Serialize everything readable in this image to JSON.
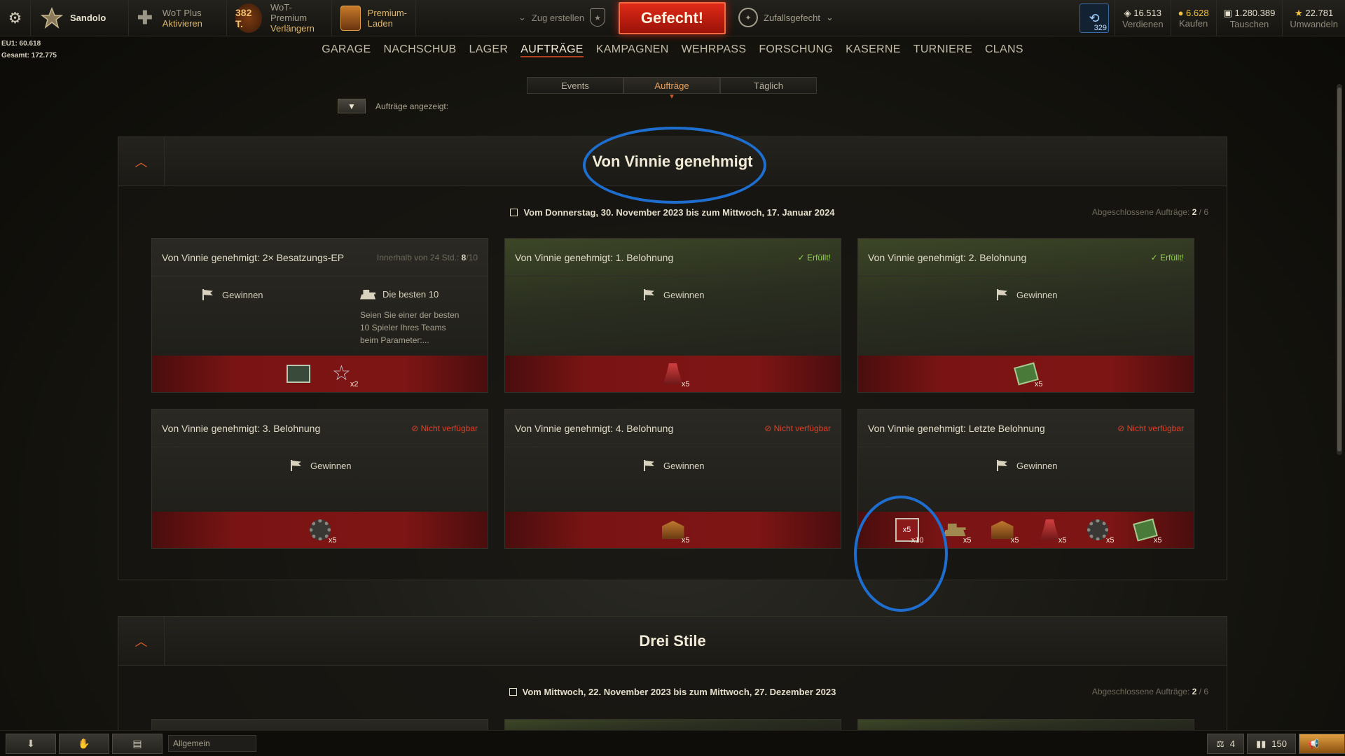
{
  "topbar": {
    "player_name": "Sandolo",
    "wot_plus_l1": "WoT Plus",
    "wot_plus_l2": "Aktivieren",
    "premium_days": "382 T.",
    "premium_l1": "WoT-Premium",
    "premium_l2": "Verlängern",
    "shop_l1": "Premium-",
    "shop_l2": "Laden",
    "platoon": "Zug erstellen",
    "battle_button": "Gefecht!",
    "battle_mode": "Zufallsgefecht",
    "bonds_count": "329",
    "currencies": [
      {
        "value": "16.513",
        "label": "Verdienen",
        "icon": "credits-icon"
      },
      {
        "value": "6.628",
        "label": "Kaufen",
        "icon": "gold-icon"
      },
      {
        "value": "1.280.389",
        "label": "Tauschen",
        "icon": "free-xp-icon"
      },
      {
        "value": "22.781",
        "label": "Umwandeln",
        "icon": "star-xp-icon"
      }
    ]
  },
  "stats": {
    "eu": "EU1: 60.618",
    "total": "Gesamt: 172.775"
  },
  "nav": [
    "GARAGE",
    "NACHSCHUB",
    "LAGER",
    "AUFTRÄGE",
    "KAMPAGNEN",
    "WEHRPASS",
    "FORSCHUNG",
    "KASERNE",
    "TURNIERE",
    "CLANS"
  ],
  "nav_active": "AUFTRÄGE",
  "subtabs": [
    "Events",
    "Aufträge",
    "Täglich"
  ],
  "subtab_active": "Aufträge",
  "filter_label": "Aufträge angezeigt:",
  "sections": [
    {
      "title": "Von Vinnie genehmigt",
      "dates": "Vom Donnerstag, 30. November 2023 bis zum Mittwoch, 17. Januar 2024",
      "done_label": "Abgeschlossene Aufträge:",
      "done_count": "2",
      "done_total": "/ 6",
      "cards": [
        {
          "title": "Von Vinnie genehmigt: 2× Besatzungs-EP",
          "status": "Innerhalb von 24 Std.:",
          "status_value": "8",
          "status_total": "/10",
          "cond1": "Gewinnen",
          "cond2": "Die besten 10",
          "cond2_desc": "Seien Sie einer der besten 10 Spieler Ihres Teams beim Parameter:..."
        },
        {
          "title": "Von Vinnie genehmigt: 1. Belohnung",
          "status": "✓ Erfüllt!",
          "cond1": "Gewinnen",
          "reward_qty": "x5"
        },
        {
          "title": "Von Vinnie genehmigt: 2. Belohnung",
          "status": "✓ Erfüllt!",
          "cond1": "Gewinnen",
          "reward_qty": "x5"
        },
        {
          "title": "Von Vinnie genehmigt: 3. Belohnung",
          "status": "Nicht verfügbar",
          "cond1": "Gewinnen",
          "reward_qty": "x5"
        },
        {
          "title": "Von Vinnie genehmigt: 4. Belohnung",
          "status": "Nicht verfügbar",
          "cond1": "Gewinnen",
          "reward_qty": "x5"
        },
        {
          "title": "Von Vinnie genehmigt: Letzte Belohnung",
          "status": "Nicht verfügbar",
          "cond1": "Gewinnen",
          "reward_framed": "x5",
          "reward_framed_qty": "x10",
          "reward_qty": "x5"
        }
      ],
      "card1_reward_qty": "x2"
    },
    {
      "title": "Drei Stile",
      "dates": "Vom Mittwoch, 22. November 2023 bis zum Mittwoch, 27. Dezember 2023",
      "done_label": "Abgeschlossene Aufträge:",
      "done_count": "2",
      "done_total": "/ 6"
    }
  ],
  "bottombar": {
    "channel": "Allgemein",
    "right1": "4",
    "right2": "150"
  },
  "colors": {
    "accent": "#d85a2a",
    "battle": "#e02a18",
    "done_green": "#8fd04a",
    "unavailable_red": "#e0402a",
    "annotation_blue": "#1e6ed0"
  }
}
